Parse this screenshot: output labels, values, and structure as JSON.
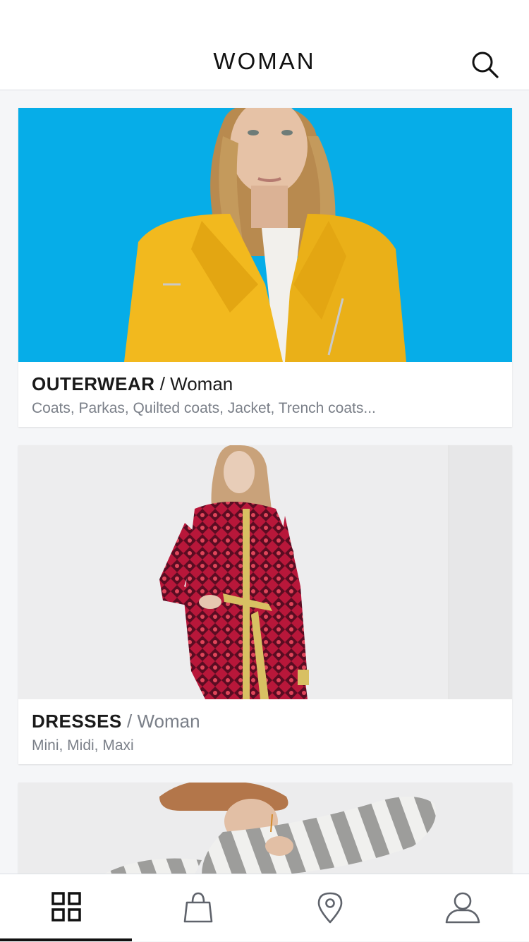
{
  "header": {
    "title": "WOMAN",
    "search_icon": "search-icon"
  },
  "categories": [
    {
      "title": "OUTERWEAR",
      "separator": " / ",
      "gender": "Woman",
      "subtitle": "Coats, Parkas, Quilted coats, Jacket, Trench coats...",
      "image_subject": "model-yellow-jacket",
      "background_color": "#06ade8",
      "garment_color": "#f2b91e"
    },
    {
      "title": "DRESSES",
      "separator": " / ",
      "gender": "Woman",
      "subtitle": "Mini, Midi, Maxi",
      "image_subject": "model-red-patterned-dress",
      "background_color": "#ededee",
      "garment_color": "#b8173a"
    },
    {
      "image_subject": "model-striped-sweater",
      "background_color": "#ececed",
      "garment_color": "#9a9a9a"
    }
  ],
  "tabbar": {
    "items": [
      {
        "icon": "grid-icon",
        "selected": true
      },
      {
        "icon": "shopping-bag-icon",
        "selected": false
      },
      {
        "icon": "location-pin-icon",
        "selected": false
      },
      {
        "icon": "user-icon",
        "selected": false
      }
    ]
  }
}
